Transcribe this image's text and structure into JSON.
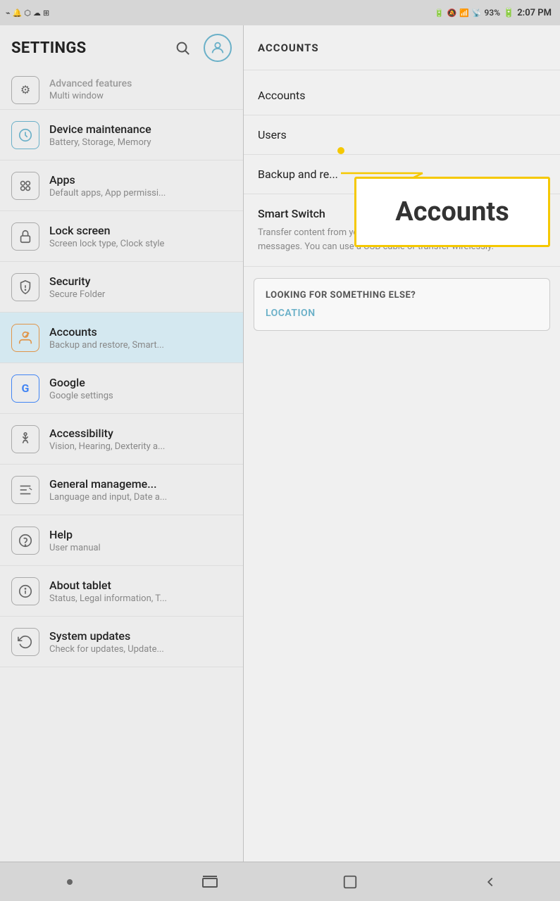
{
  "statusBar": {
    "batteryLevel": "93%",
    "time": "2:07 PM",
    "icons": [
      "notification",
      "mute",
      "wifi",
      "signal"
    ]
  },
  "leftPanel": {
    "title": "SETTINGS",
    "searchLabel": "Search",
    "profileLabel": "Profile",
    "items": [
      {
        "id": "advanced",
        "title": "Advanced features",
        "subtitle": "Multi window",
        "icon": "⚙",
        "iconStyle": "default",
        "partial": true
      },
      {
        "id": "device-maintenance",
        "title": "Device maintenance",
        "subtitle": "Battery, Storage, Memory",
        "icon": "🔄",
        "iconStyle": "teal"
      },
      {
        "id": "apps",
        "title": "Apps",
        "subtitle": "Default apps, App permissi...",
        "icon": "⬡",
        "iconStyle": "default"
      },
      {
        "id": "lock-screen",
        "title": "Lock screen",
        "subtitle": "Screen lock type, Clock style",
        "icon": "🔒",
        "iconStyle": "default"
      },
      {
        "id": "security",
        "title": "Security",
        "subtitle": "Secure Folder",
        "icon": "🛡",
        "iconStyle": "default"
      },
      {
        "id": "accounts",
        "title": "Accounts",
        "subtitle": "Backup and restore, Smart...",
        "icon": "🔑",
        "iconStyle": "orange",
        "active": true
      },
      {
        "id": "google",
        "title": "Google",
        "subtitle": "Google settings",
        "icon": "G",
        "iconStyle": "default"
      },
      {
        "id": "accessibility",
        "title": "Accessibility",
        "subtitle": "Vision, Hearing, Dexterity a...",
        "icon": "♿",
        "iconStyle": "default"
      },
      {
        "id": "general-management",
        "title": "General manageme...",
        "subtitle": "Language and input, Date a...",
        "icon": "☰",
        "iconStyle": "default"
      },
      {
        "id": "help",
        "title": "Help",
        "subtitle": "User manual",
        "icon": "?",
        "iconStyle": "default"
      },
      {
        "id": "about-tablet",
        "title": "About tablet",
        "subtitle": "Status, Legal information, T...",
        "icon": "ℹ",
        "iconStyle": "default"
      },
      {
        "id": "system-updates",
        "title": "System updates",
        "subtitle": "Check for updates, Update...",
        "icon": "↺",
        "iconStyle": "default"
      }
    ]
  },
  "rightPanel": {
    "header": "ACCOUNTS",
    "menuItems": [
      {
        "id": "accounts-menu",
        "title": "Accounts"
      },
      {
        "id": "users-menu",
        "title": "Users"
      },
      {
        "id": "backup-menu",
        "title": "Backup and re..."
      }
    ],
    "smartSwitch": {
      "title": "Smart Switch",
      "description": "Transfer content from your old device, including images, contacts, and messages. You can use a USB cable or transfer wirelessly."
    },
    "lookingForBox": {
      "heading": "LOOKING FOR SOMETHING ELSE?",
      "link": "LOCATION"
    }
  },
  "callout": {
    "text": "Accounts"
  },
  "bottomNav": {
    "items": [
      {
        "id": "dot-nav",
        "icon": "•"
      },
      {
        "id": "menu-nav",
        "icon": "⊟"
      },
      {
        "id": "home-nav",
        "icon": "⬜"
      },
      {
        "id": "back-nav",
        "icon": "←"
      }
    ]
  }
}
